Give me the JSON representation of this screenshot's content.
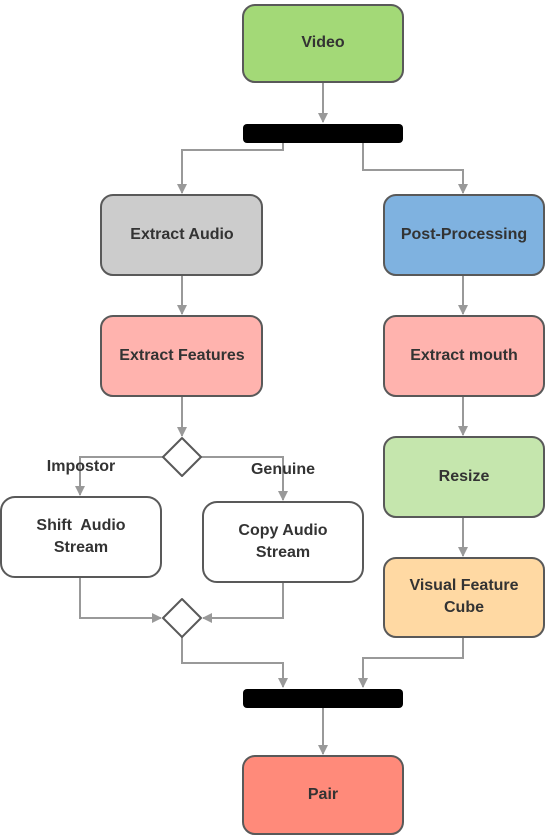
{
  "nodes": {
    "video": {
      "label": "Video",
      "color": "#a3d977"
    },
    "extract_audio": {
      "label": "Extract Audio",
      "color": "#cccccc"
    },
    "post_processing": {
      "label": "Post-Processing",
      "color": "#7fb2e0"
    },
    "extract_features": {
      "label": "Extract Features",
      "color": "#ffb3ae"
    },
    "extract_mouth": {
      "label": "Extract mouth",
      "color": "#ffb3ae"
    },
    "shift_audio": {
      "label_line1": "Shift  Audio",
      "label_line2": "Stream",
      "color": "#ffffff"
    },
    "copy_audio": {
      "label_line1": "Copy Audio",
      "label_line2": "Stream",
      "color": "#ffffff"
    },
    "resize": {
      "label": "Resize",
      "color": "#c5e6ad"
    },
    "visual_feature_cube": {
      "label_line1": "Visual Feature",
      "label_line2": "Cube",
      "color": "#ffd9a3"
    },
    "pair": {
      "label": "Pair",
      "color": "#ff8a7a"
    }
  },
  "edge_labels": {
    "impostor": "Impostor",
    "genuine": "Genuine"
  }
}
